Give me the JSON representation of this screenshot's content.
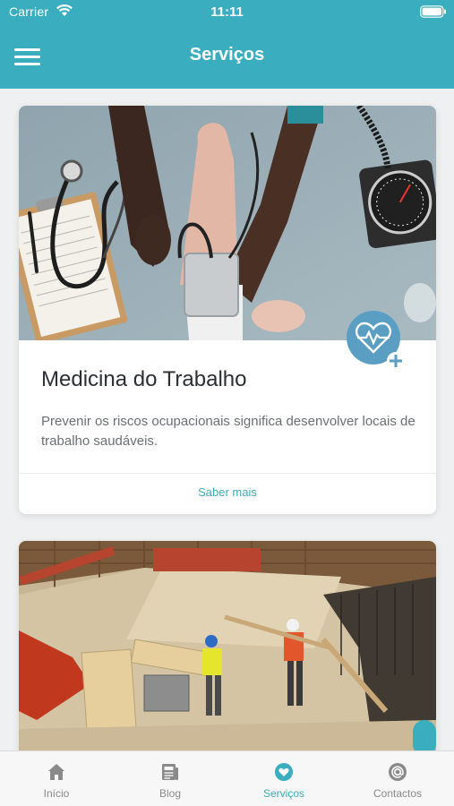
{
  "status_bar": {
    "carrier": "Carrier",
    "time": "11:11"
  },
  "header": {
    "title": "Serviços"
  },
  "cards": [
    {
      "title": "Medicina do Trabalho",
      "description": "Prevenir os riscos ocupacionais significa desenvolver locais de trabalho saudáveis.",
      "link": "Saber mais",
      "badge_icon": "heart-pulse-plus-icon"
    },
    {
      "badge_icon": "construction-safety-icon"
    }
  ],
  "tabbar": {
    "tabs": [
      {
        "label": "Início",
        "icon": "home-icon"
      },
      {
        "label": "Blog",
        "icon": "newspaper-icon"
      },
      {
        "label": "Serviços",
        "icon": "heart-icon",
        "active": true
      },
      {
        "label": "Contactos",
        "icon": "at-icon"
      }
    ]
  },
  "colors": {
    "primary": "#3aaebf",
    "tab_inactive": "#8a8a8a",
    "background": "#eef0f1"
  }
}
